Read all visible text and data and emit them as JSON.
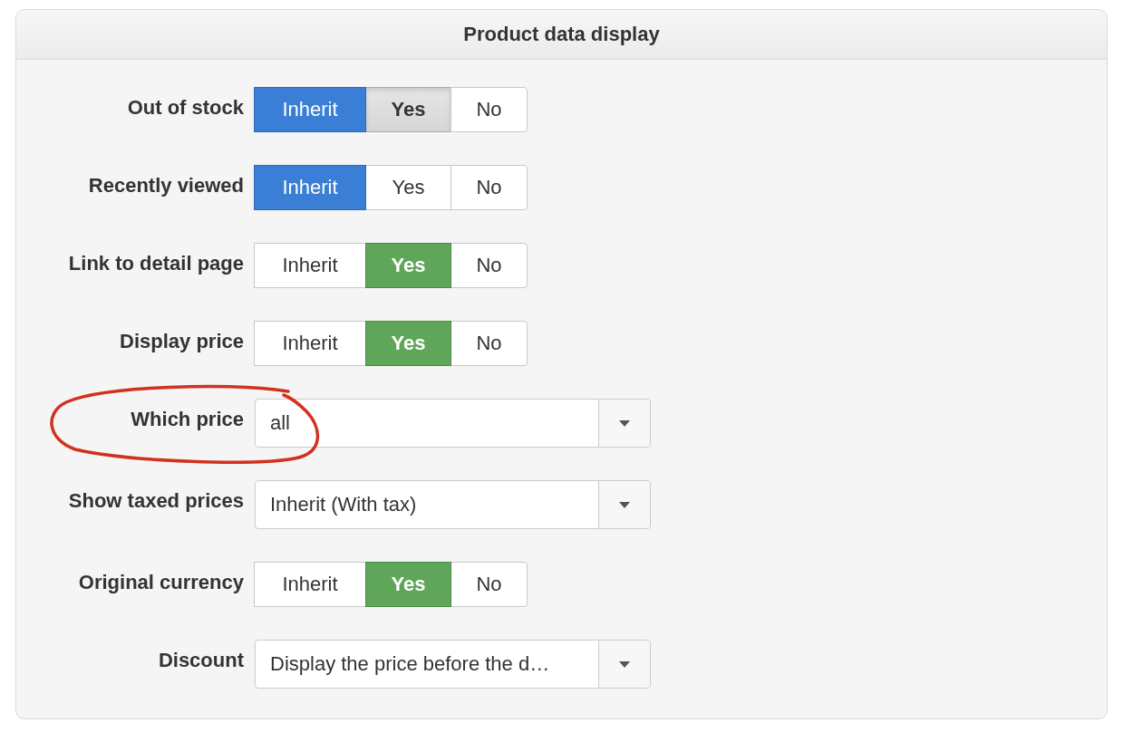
{
  "panel": {
    "title": "Product data display"
  },
  "fields": [
    {
      "kind": "toggle",
      "label": "Out of stock",
      "annotated": false,
      "options": [
        {
          "label": "Inherit",
          "selected": true,
          "hovered": false
        },
        {
          "label": "Yes",
          "selected": false,
          "hovered": true
        },
        {
          "label": "No",
          "selected": false,
          "hovered": false
        }
      ]
    },
    {
      "kind": "toggle",
      "label": "Recently viewed",
      "annotated": false,
      "options": [
        {
          "label": "Inherit",
          "selected": true,
          "hovered": false
        },
        {
          "label": "Yes",
          "selected": false,
          "hovered": false
        },
        {
          "label": "No",
          "selected": false,
          "hovered": false
        }
      ]
    },
    {
      "kind": "toggle",
      "label": "Link to detail page",
      "annotated": false,
      "options": [
        {
          "label": "Inherit",
          "selected": false,
          "hovered": false
        },
        {
          "label": "Yes",
          "selected": true,
          "hovered": false
        },
        {
          "label": "No",
          "selected": false,
          "hovered": false
        }
      ]
    },
    {
      "kind": "toggle",
      "label": "Display price",
      "annotated": false,
      "options": [
        {
          "label": "Inherit",
          "selected": false,
          "hovered": false
        },
        {
          "label": "Yes",
          "selected": true,
          "hovered": false
        },
        {
          "label": "No",
          "selected": false,
          "hovered": false
        }
      ]
    },
    {
      "kind": "select",
      "label": "Which price",
      "annotated": true,
      "value": "all"
    },
    {
      "kind": "select",
      "label": "Show taxed prices",
      "annotated": false,
      "value": "Inherit (With tax)"
    },
    {
      "kind": "toggle",
      "label": "Original currency",
      "annotated": false,
      "options": [
        {
          "label": "Inherit",
          "selected": false,
          "hovered": false
        },
        {
          "label": "Yes",
          "selected": true,
          "hovered": false
        },
        {
          "label": "No",
          "selected": false,
          "hovered": false
        }
      ]
    },
    {
      "kind": "select",
      "label": "Discount",
      "annotated": false,
      "value": "Display the price before the d…"
    }
  ]
}
